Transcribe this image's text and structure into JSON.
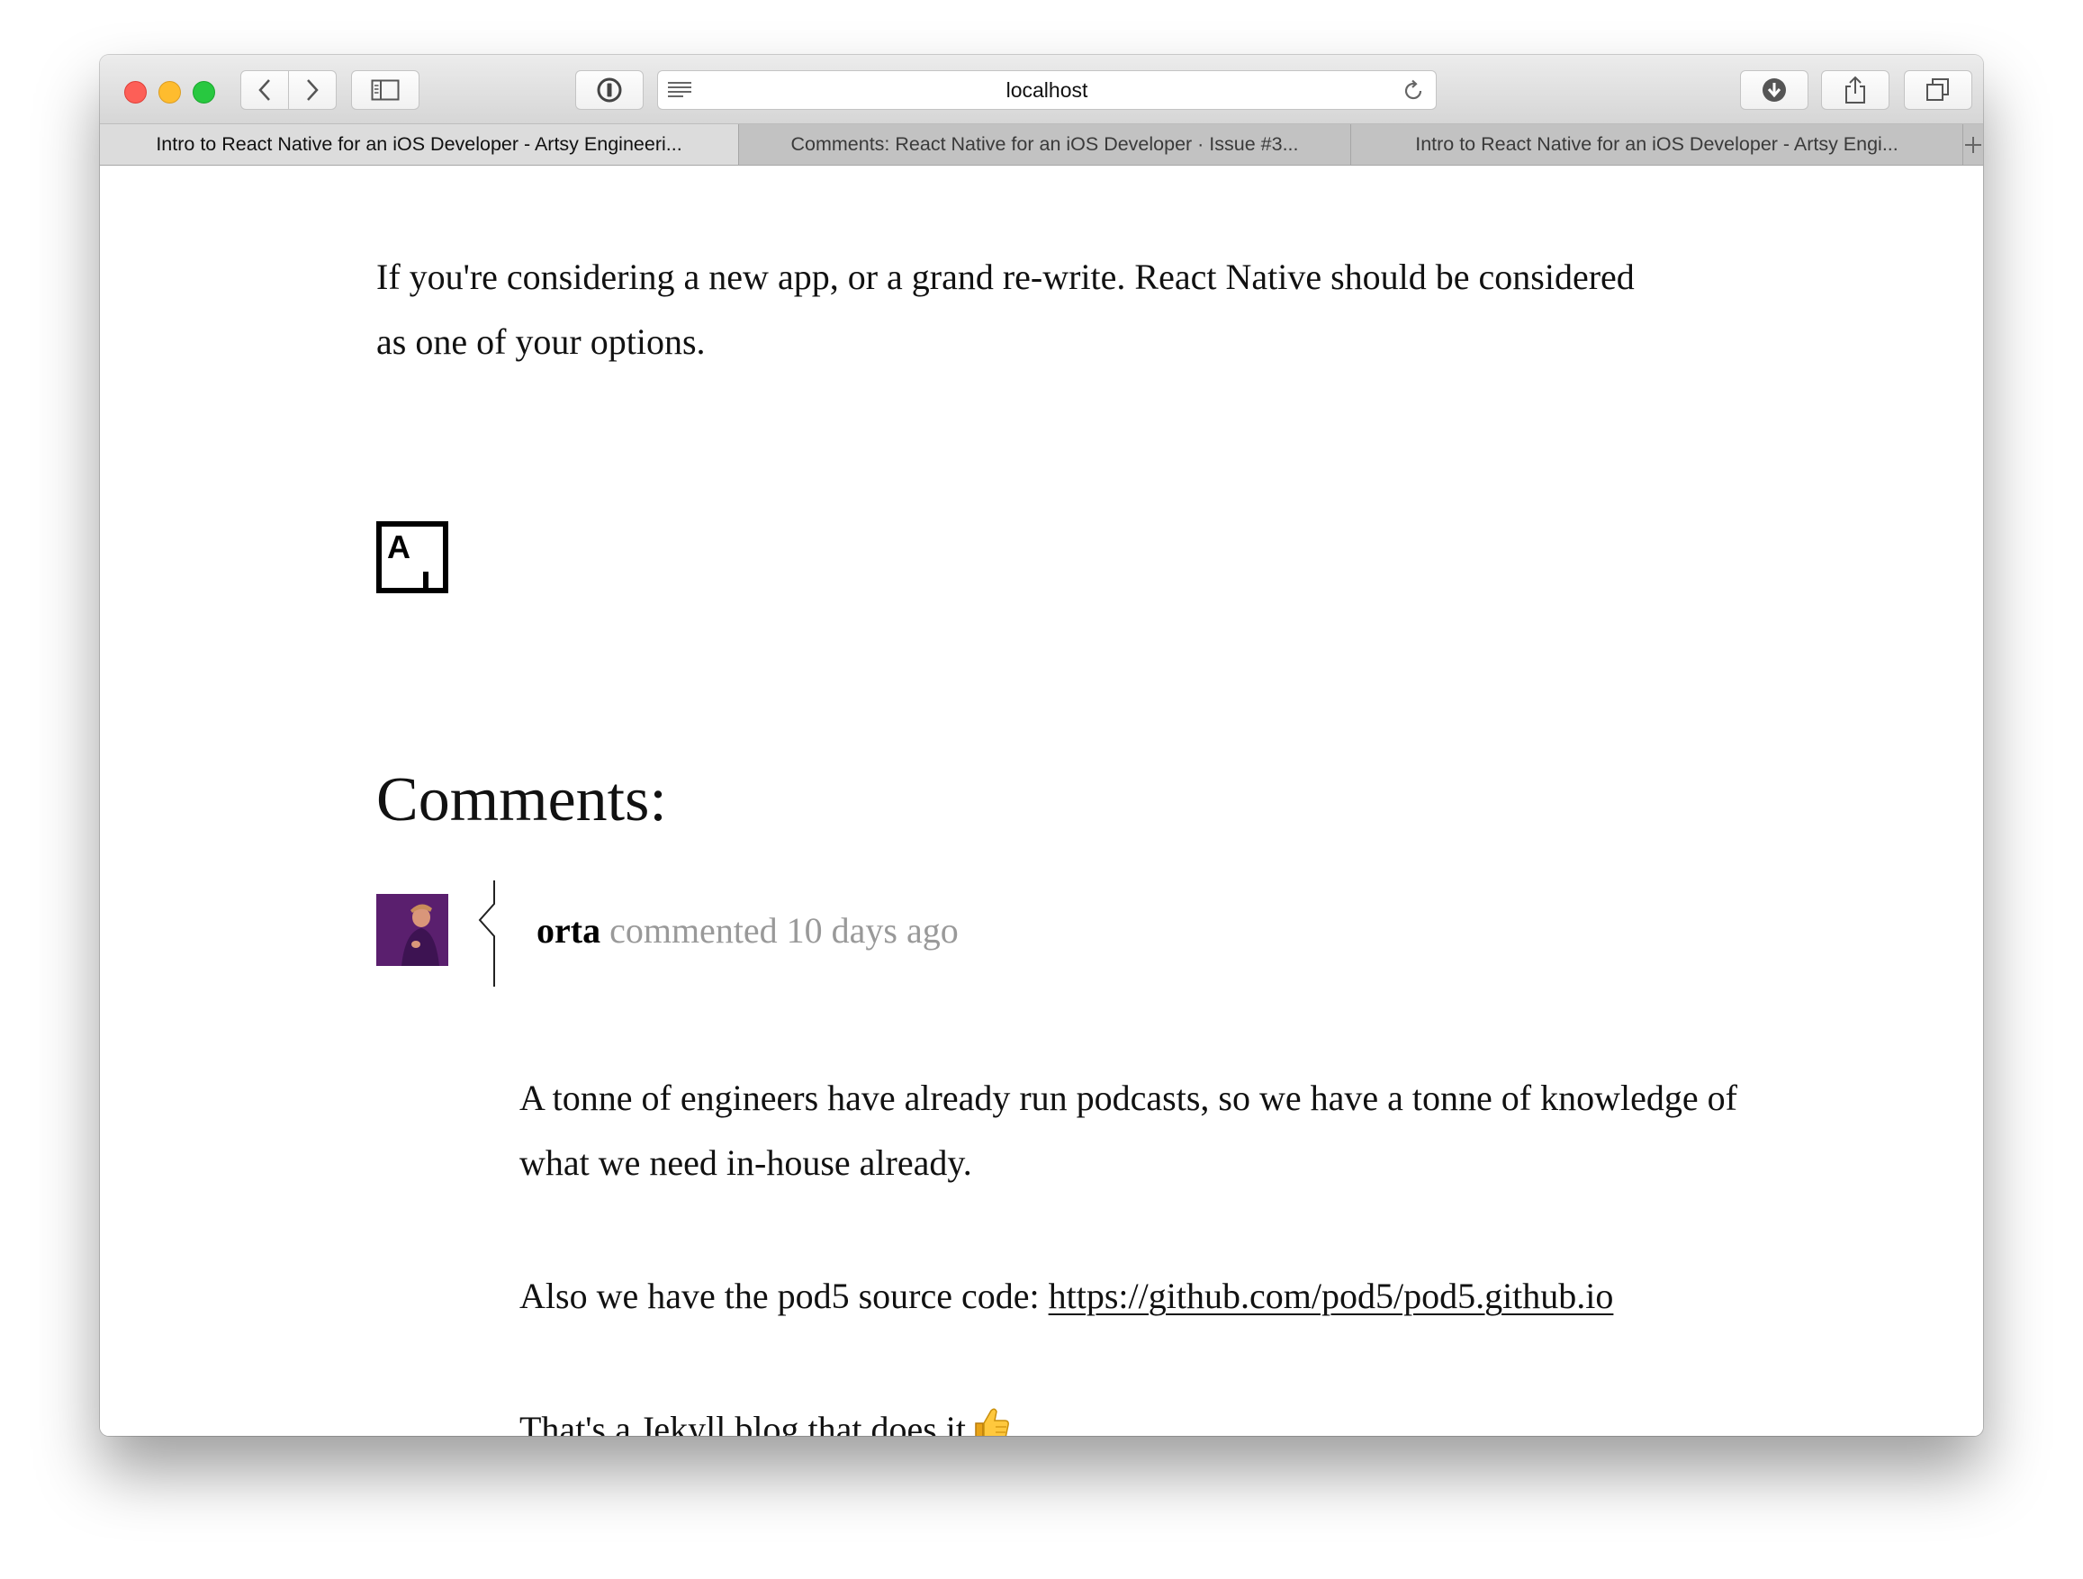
{
  "browser": {
    "url": "localhost",
    "tabs": [
      {
        "label": "Intro to React Native for an iOS Developer - Artsy Engineeri...",
        "active": true
      },
      {
        "label": "Comments: React Native for an iOS Developer · Issue #3...",
        "active": false
      },
      {
        "label": "Intro to React Native for an iOS Developer - Artsy Engi...",
        "active": false
      }
    ]
  },
  "article": {
    "closing_paragraph": "If you're considering a new app, or a grand re-write. React Native should be considered as one of your options.",
    "logo_letter": "A"
  },
  "comments": {
    "heading": "Comments:",
    "items": [
      {
        "author": "orta",
        "meta": "commented 10 days ago",
        "paragraph_1": "A tonne of engineers have already run podcasts, so we have a tonne of knowledge of what we need in-house already.",
        "paragraph_2_prefix": "Also we have the pod5 source code: ",
        "paragraph_2_link": "https://github.com/pod5/pod5.github.io",
        "paragraph_3": "That's a Jekyll blog that does it",
        "paragraph_3_emoji": "thumbs-up-icon"
      }
    ]
  },
  "colors": {
    "close": "#fd5f57",
    "minimize": "#febc2e",
    "zoom": "#28c840",
    "meta_text": "#999999"
  }
}
